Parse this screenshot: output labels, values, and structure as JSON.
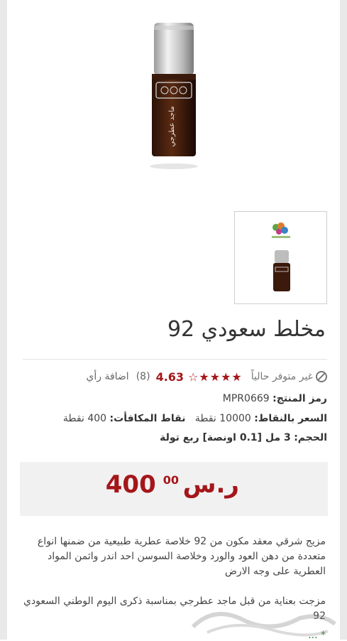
{
  "product": {
    "title": "مخلط سعودي 92",
    "availability": "غير متوفر حالياً",
    "stars_icon": "★★★★☆",
    "rating": "4.63",
    "rating_count": "(8)",
    "review_link": "اضافة رأي",
    "rating_value": 4.63,
    "bottle_text": "ماجد عطرجي"
  },
  "details": {
    "code_label": "رمز المنتج:",
    "code_value": "MPR0669",
    "points_price_label": "السعر بالنقاط:",
    "points_price_value": "10000 نقطة",
    "reward_points_label": "نقاط المكافأت:",
    "reward_points_value": "400 نقطة",
    "size_label": "الحجم:",
    "size_value": "3 مل [0.1 اونصة] ربع تولة"
  },
  "price": {
    "whole": "400",
    "cents": "00",
    "currency": "ر.س"
  },
  "description": {
    "para1": "مزيج شرقي معقد مكون من 92 خلاصة عطرية طبيعية من ضمنها انواع متعددة من دهن العود والورد وخلاصة السوسن احد اندر واثمن المواد العطرية على وجه الارض",
    "para2": "مزجت بعناية من قبل ماجد عطرجي بمناسبة ذكرى اليوم الوطني السعودي 92",
    "para3": "* ..."
  },
  "colors": {
    "accent": "#a4161a",
    "price_bg": "#f2f1f1",
    "frame": "#e9e9e9"
  }
}
